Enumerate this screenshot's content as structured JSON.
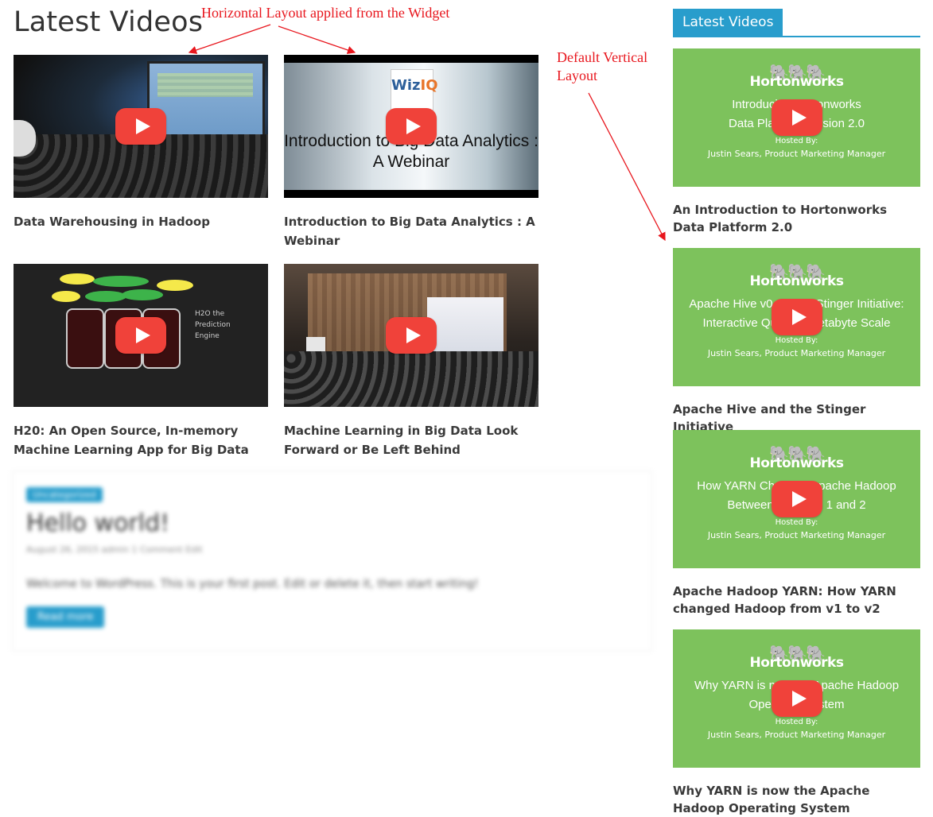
{
  "page": {
    "title": "Latest Videos"
  },
  "annotations": {
    "horizontal": "Horizontal Layout applied from the Widget",
    "vertical_line1": "Default Vertical",
    "vertical_line2": "Layout",
    "color": "#e8161d"
  },
  "main_videos": [
    {
      "title": "Data Warehousing in Hadoop",
      "icon": "play-icon"
    },
    {
      "title": "Introduction to Big Data Analytics : A Webinar",
      "icon": "play-icon",
      "thumb_text": "Introduction to Big Data Analytics : A Webinar",
      "thumb_logo": "WizIQ"
    },
    {
      "title": "H20: An Open Source, In-memory Machine Learning App for Big Data",
      "icon": "play-icon",
      "thumb_text": "H2O the Prediction Engine"
    },
    {
      "title": "Machine Learning in Big Data Look Forward or Be Left Behind",
      "icon": "play-icon"
    }
  ],
  "sidebar": {
    "widget_title": "Latest Videos",
    "accent_color": "#289dcc",
    "videos": [
      {
        "title": "An Introduction to Hortonworks Data Platform 2.0",
        "thumb_brand": "Hortonworks",
        "thumb_line1": "Introducing Hortonworks",
        "thumb_line2": "Data Platform Version 2.0",
        "thumb_hosted": "Hosted By:",
        "thumb_person": "Justin Sears, Product Marketing Manager"
      },
      {
        "title": "Apache Hive and the Stinger Initiative",
        "thumb_brand": "Hortonworks",
        "thumb_line1": "Apache Hive v0.13 and Stinger Initiative:",
        "thumb_line2": "Interactive Query at Petabyte Scale",
        "thumb_hosted": "Hosted By:",
        "thumb_person": "Justin Sears, Product Marketing Manager"
      },
      {
        "title": "Apache Hadoop YARN: How YARN changed Hadoop from v1 to v2",
        "thumb_brand": "Hortonworks",
        "thumb_line1": "How YARN Changed Apache Hadoop",
        "thumb_line2": "Between Versions 1 and 2",
        "thumb_hosted": "Hosted By:",
        "thumb_person": "Justin Sears, Product Marketing Manager"
      },
      {
        "title": "Why YARN is now the Apache Hadoop Operating System",
        "thumb_brand": "Hortonworks",
        "thumb_line1": "Why YARN is now the Apache Hadoop",
        "thumb_line2": "Operating System",
        "thumb_hosted": "Hosted By:",
        "thumb_person": "Justin Sears, Product Marketing Manager"
      }
    ]
  },
  "blurred_post": {
    "category": "Uncategorized",
    "title": "Hello world!",
    "meta": "August 26, 2015   admin   1 Comment   Edit",
    "body": "Welcome to WordPress. This is your first post. Edit or delete it, then start writing!",
    "button": "Read more"
  }
}
